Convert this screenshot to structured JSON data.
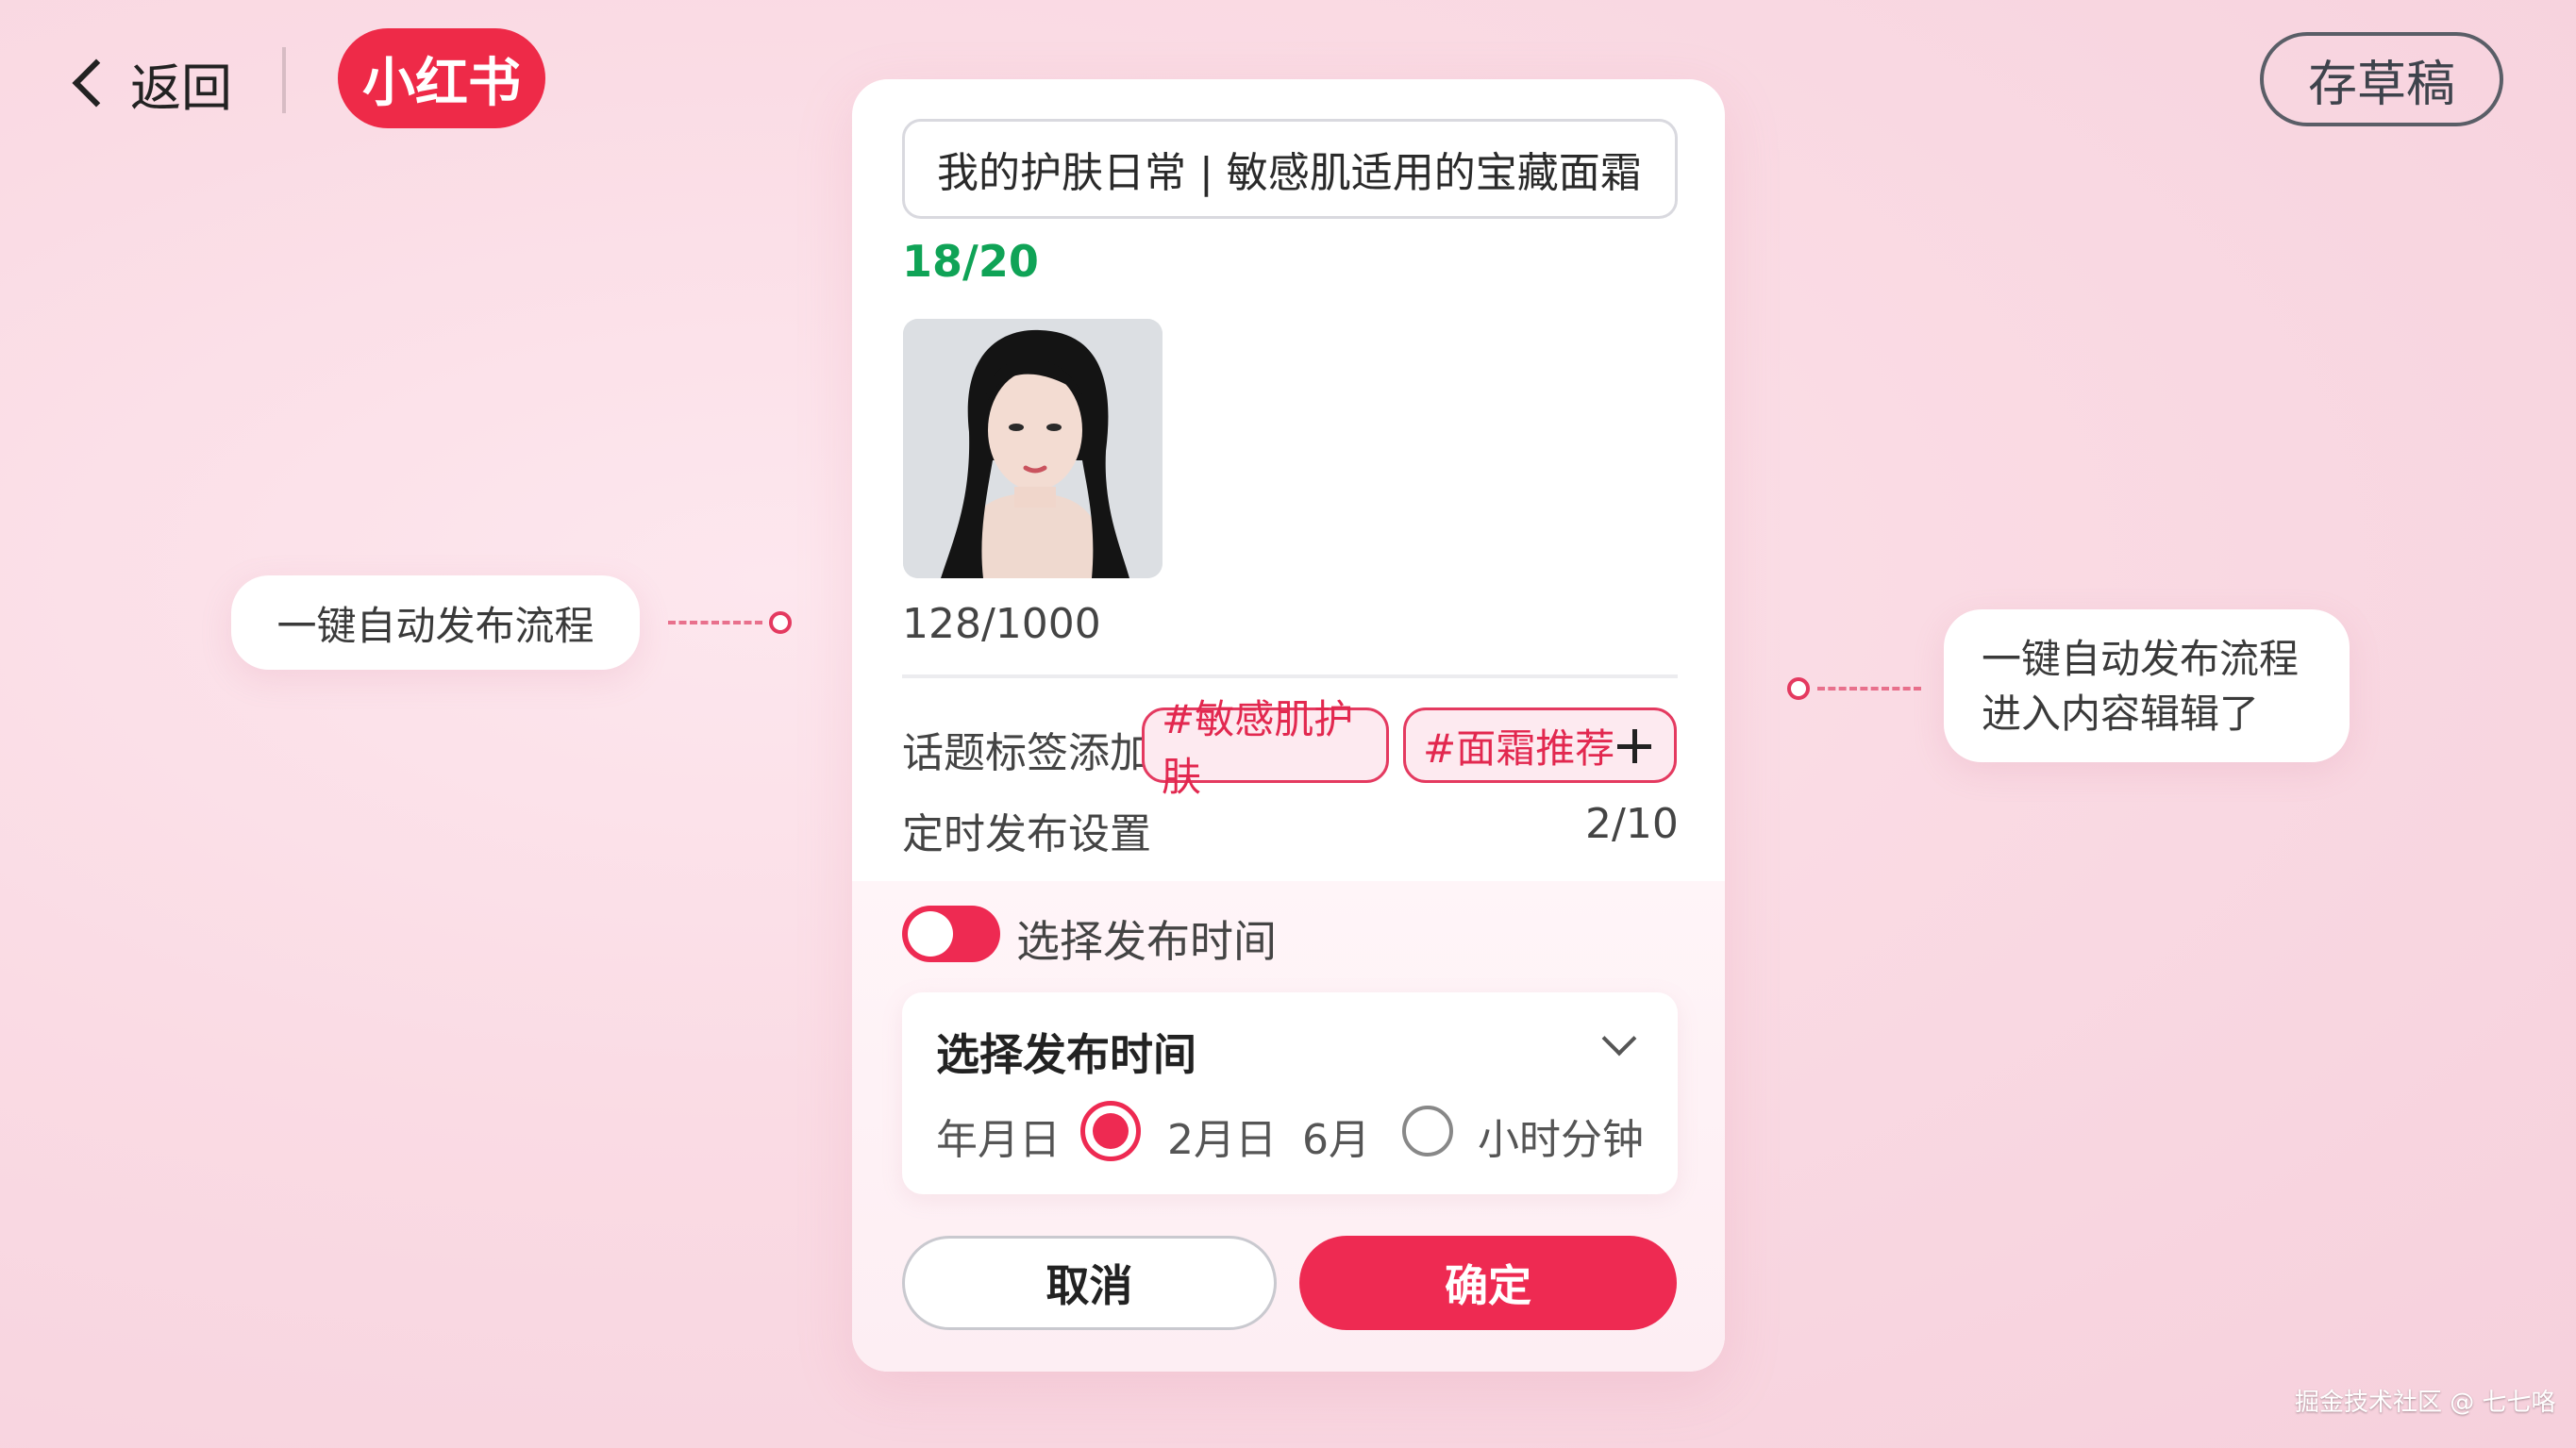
{
  "header": {
    "back_label": "返回",
    "logo_text": "小红书",
    "draft_label": "存草稿"
  },
  "editor": {
    "title_value": "我的护肤日常 | 敏感肌适用的宝藏面霜",
    "title_count": "18/20",
    "body_count": "128/1000",
    "tag_label": "话题标签添加",
    "tags": [
      "#敏感肌护肤",
      "#面霜推荐"
    ],
    "schedule_label": "定时发布设置",
    "schedule_count": "2/10",
    "toggle_label": "选择发布时间",
    "toggle_on": true,
    "picker": {
      "title": "选择发布时间",
      "option_date": "年月日",
      "option_value": "2月日",
      "option_month": "6月",
      "option_time": "小时分钟",
      "selected": "2月日"
    },
    "cancel_label": "取消",
    "confirm_label": "确定"
  },
  "callouts": {
    "left": "一键自动发布流程",
    "right_line1": "一键自动发布流程",
    "right_line2": "进入内容辑辑了"
  },
  "watermark": "掘金技术社区 @ 七七咯",
  "colors": {
    "accent": "#ee2a52",
    "count_green": "#0fa356",
    "background": "#fadbe4"
  }
}
